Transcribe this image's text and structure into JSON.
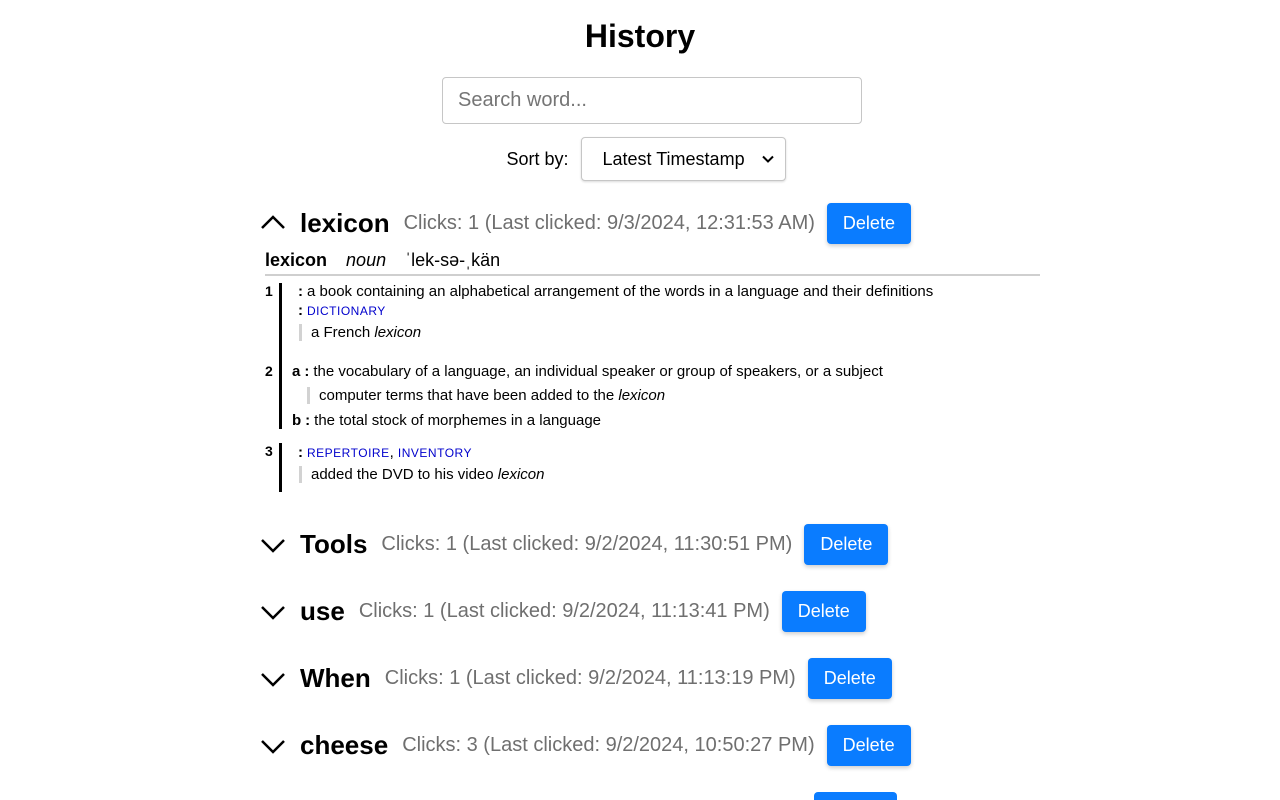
{
  "page": {
    "title": "History"
  },
  "search": {
    "placeholder": "Search word...",
    "value": ""
  },
  "sort": {
    "label": "Sort by:",
    "selected": "Latest Timestamp"
  },
  "entries": [
    {
      "word": "lexicon",
      "clicks_text": "Clicks: 1 (Last clicked: 9/3/2024, 12:31:53 AM)",
      "expanded": true,
      "delete_label": "Delete"
    },
    {
      "word": "Tools",
      "clicks_text": "Clicks: 1 (Last clicked: 9/2/2024, 11:30:51 PM)",
      "expanded": false,
      "delete_label": "Delete"
    },
    {
      "word": "use",
      "clicks_text": "Clicks: 1 (Last clicked: 9/2/2024, 11:13:41 PM)",
      "expanded": false,
      "delete_label": "Delete"
    },
    {
      "word": "When",
      "clicks_text": "Clicks: 1 (Last clicked: 9/2/2024, 11:13:19 PM)",
      "expanded": false,
      "delete_label": "Delete"
    },
    {
      "word": "cheese",
      "clicks_text": "Clicks: 3 (Last clicked: 9/2/2024, 10:50:27 PM)",
      "expanded": false,
      "delete_label": "Delete"
    }
  ],
  "definition": {
    "headword": "lexicon",
    "part_of_speech": "noun",
    "pronunciation": "ˈlek-sə-ˌkän",
    "senses": [
      {
        "number": "1",
        "text": "a book containing an alphabetical arrangement of the words in a language and their definitions",
        "synonym": "dictionary",
        "example_pre": "a French ",
        "example_italic": "lexicon",
        "example_post": ""
      },
      {
        "number": "2",
        "sub_a_letter": "a",
        "sub_a_text": "the vocabulary of a language, an individual speaker or group of speakers, or a subject",
        "sub_a_example_pre": "computer terms that have been added to the ",
        "sub_a_example_italic": "lexicon",
        "sub_b_letter": "b",
        "sub_b_text": "the total stock of morphemes in a language"
      },
      {
        "number": "3",
        "synonym_1": "repertoire",
        "synonym_sep": ", ",
        "synonym_2": "inventory",
        "example_pre": "added the DVD to his video ",
        "example_italic": "lexicon"
      }
    ]
  },
  "colors": {
    "accent": "#0a7cff",
    "muted_text": "#6f6f6f",
    "synonym_link": "#0000cc"
  }
}
